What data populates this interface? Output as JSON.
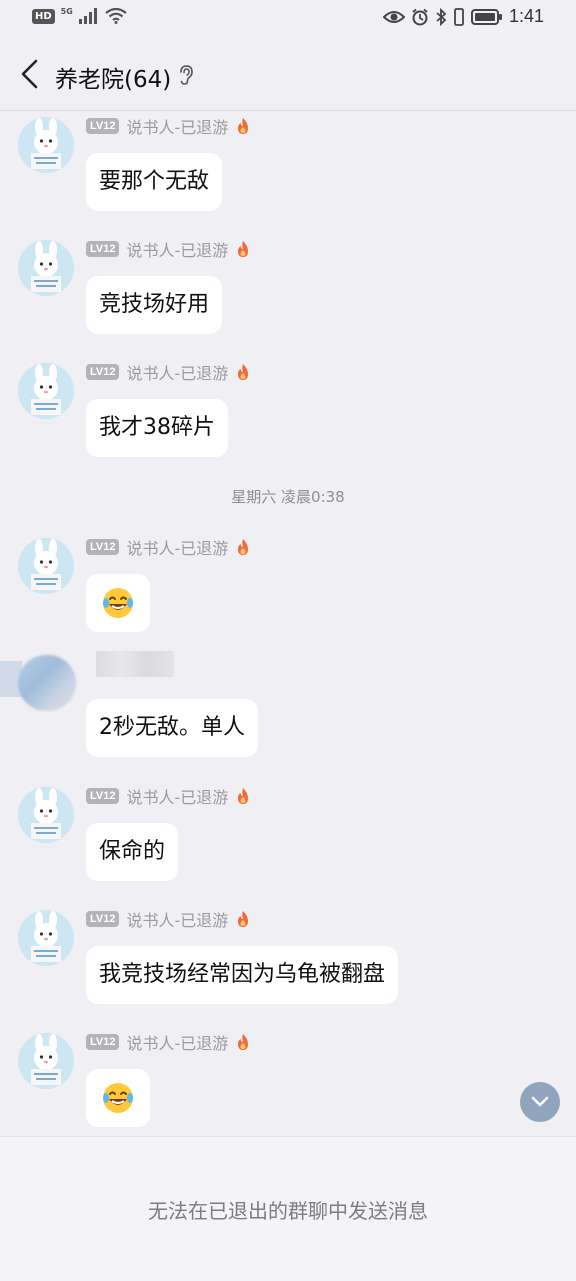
{
  "status_bar": {
    "hd": "HD",
    "network": "5G",
    "time": "1:41",
    "icons": [
      "eye-icon",
      "alarm-icon",
      "bluetooth-icon",
      "vibrate-icon",
      "battery-icon"
    ]
  },
  "header": {
    "title": "养老院(64)",
    "back_icon": "chevron-left-icon",
    "ear_icon": "ear-icon"
  },
  "sender": {
    "level": "LV12",
    "name": "说书人-已退游",
    "badge_icon": "fire-icon"
  },
  "messages": [
    {
      "text": "要那个无敌"
    },
    {
      "text": "竞技场好用"
    },
    {
      "text": "我才38碎片"
    },
    {
      "separator": "星期六 凌晨0:38"
    },
    {
      "emoji": "laughing-crying-emoji"
    },
    {
      "text": "2秒无敌。单人",
      "sender_hidden": true
    },
    {
      "text": "保命的"
    },
    {
      "text": "我竞技场经常因为乌龟被翻盘"
    },
    {
      "emoji": "laughing-crying-emoji"
    }
  ],
  "footer": {
    "notice": "无法在已退出的群聊中发送消息"
  },
  "colors": {
    "background": "#efeff4",
    "bubble": "#ffffff",
    "level_badge": "#b3b3b8",
    "scroll_button": "#8fa4bd"
  }
}
